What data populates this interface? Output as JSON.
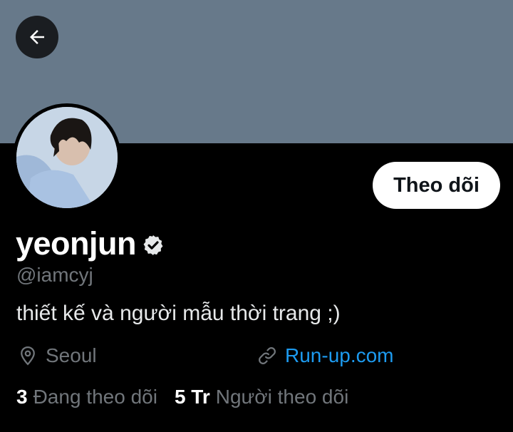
{
  "profile": {
    "display_name": "yeonjun",
    "handle": "@iamcyj",
    "bio": "thiết kế và người mẫu thời trang ;)",
    "verified": true,
    "location": "Seoul",
    "website": "Run-up.com"
  },
  "actions": {
    "follow_label": "Theo dõi"
  },
  "stats": {
    "following_count": "3",
    "following_label": "Đang theo dõi",
    "followers_count": "5 Tr",
    "followers_label": "Người theo dõi"
  },
  "icons": {
    "back": "arrow-left-icon",
    "verified": "verified-badge-icon",
    "location": "location-pin-icon",
    "link": "link-icon"
  },
  "colors": {
    "banner": "#67798a",
    "background": "#000000",
    "link": "#1d9bf0",
    "secondary_text": "#71767b"
  }
}
